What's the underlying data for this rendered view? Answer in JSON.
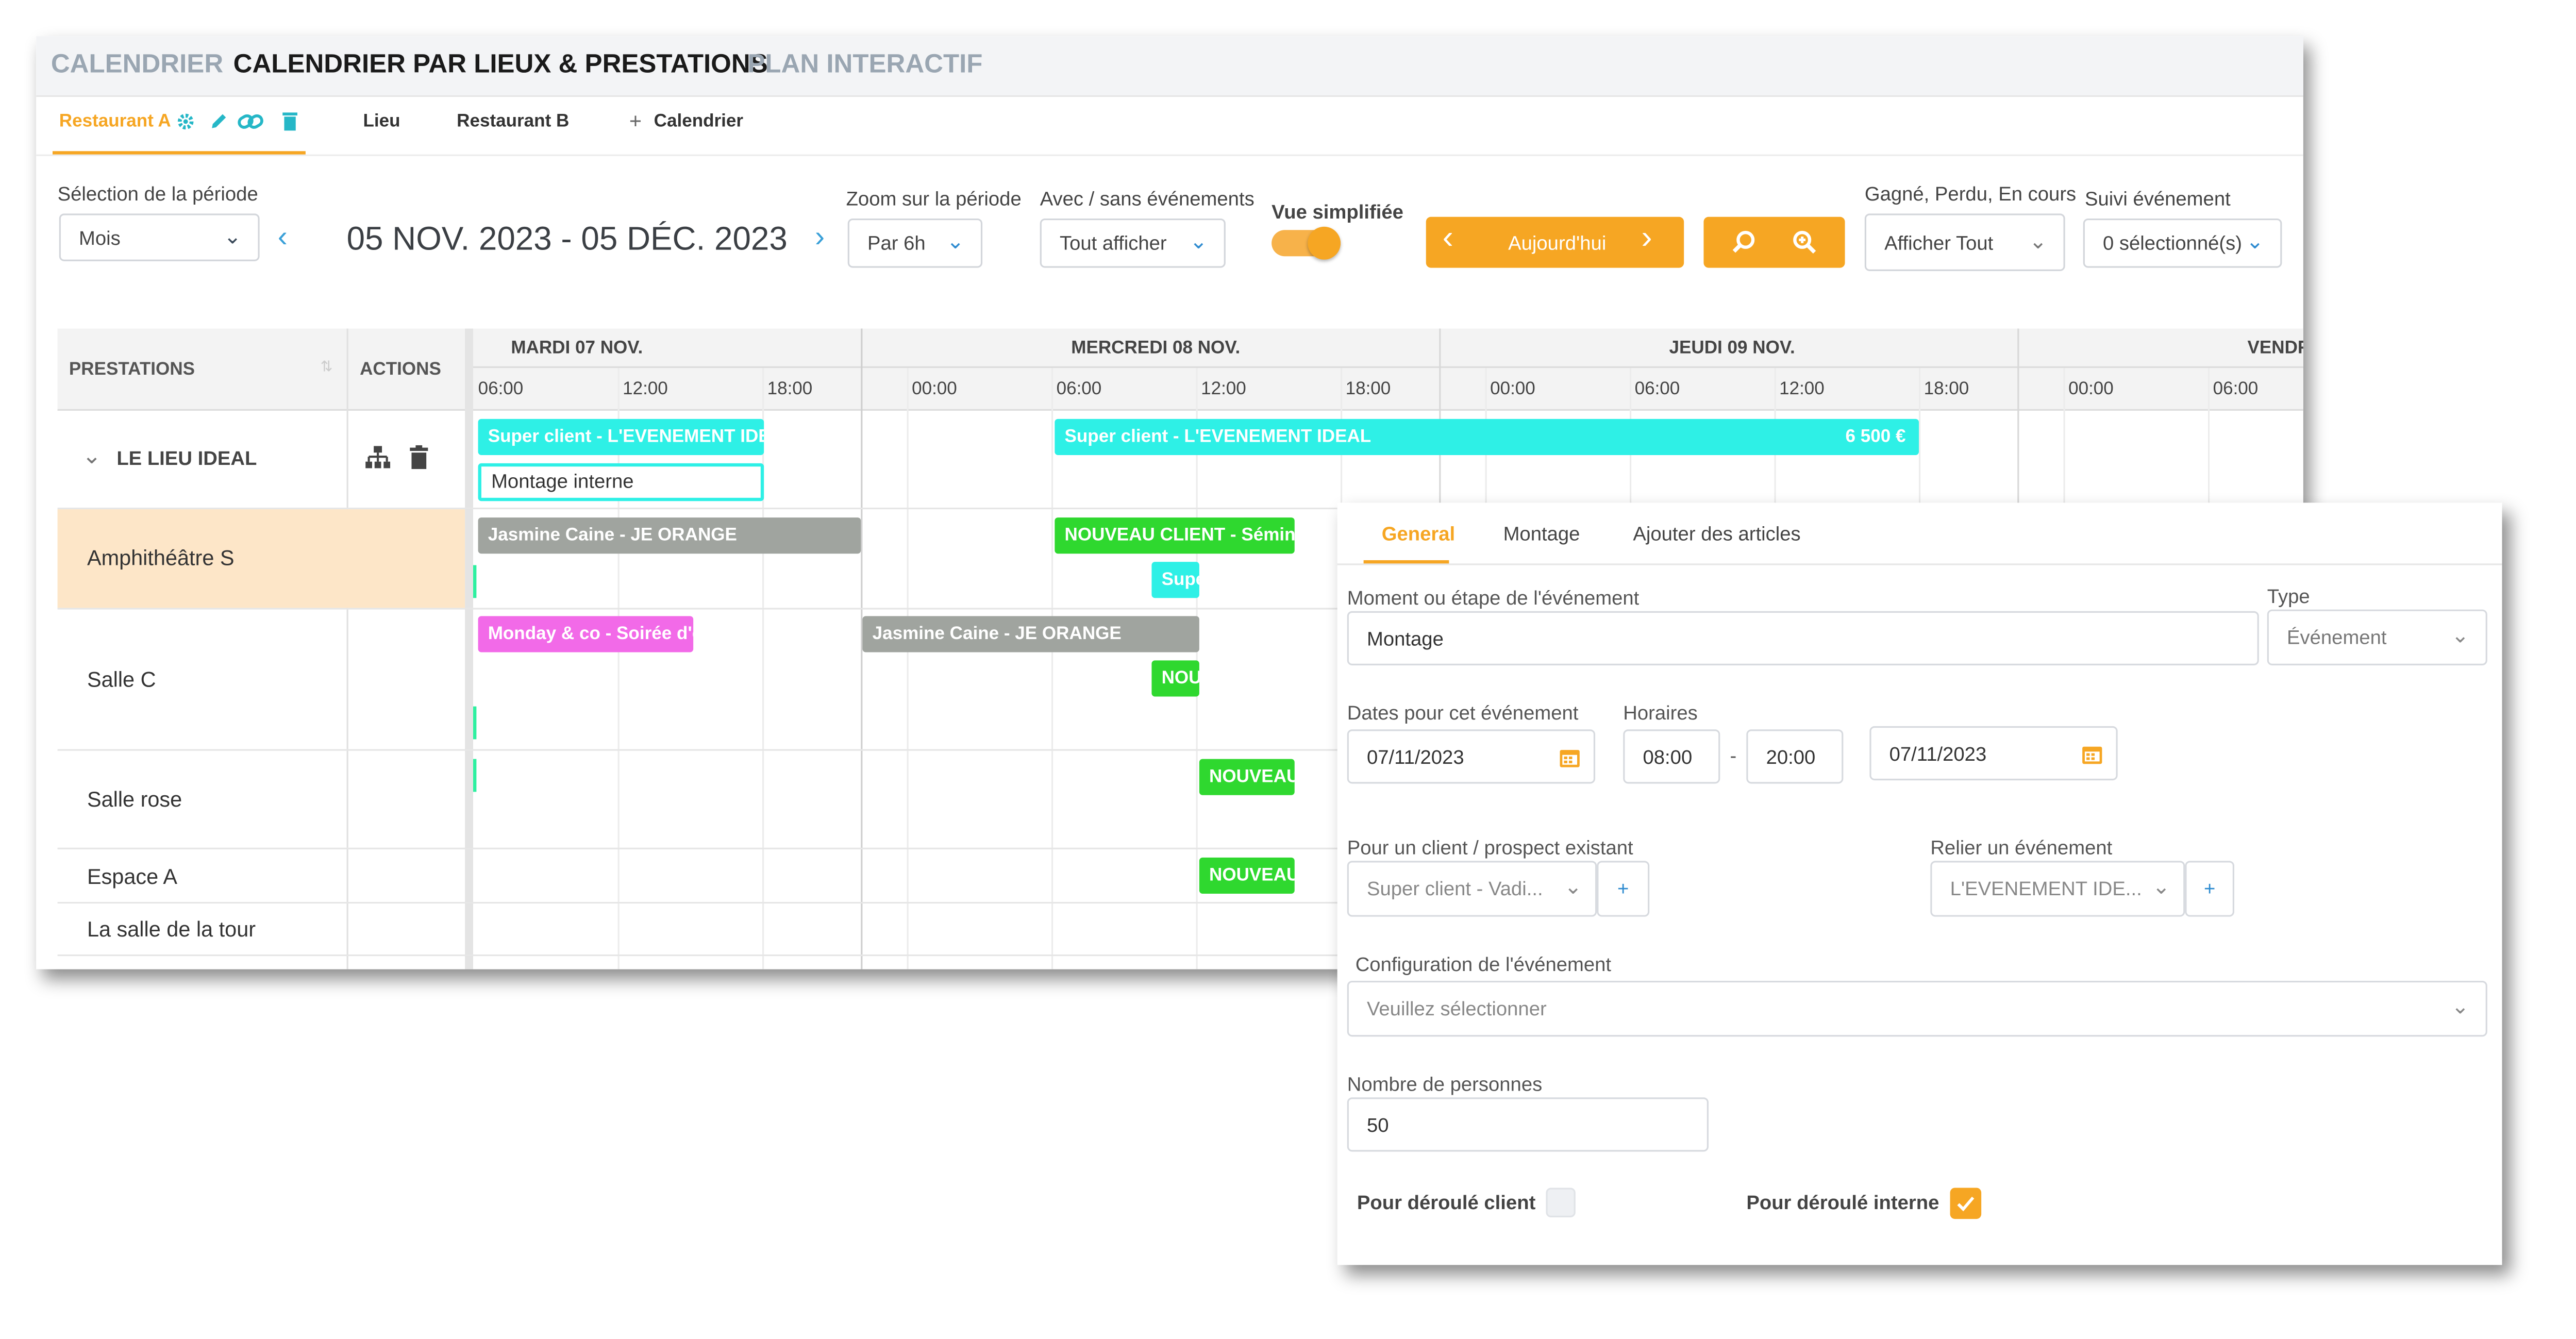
{
  "top_tabs": [
    "CALENDRIER",
    "CALENDRIER PAR LIEUX & PRESTATIONS",
    "PLAN INTERACTIF"
  ],
  "sub_tabs": {
    "restaurant_a": "Restaurant A",
    "lieu": "Lieu",
    "restaurant_b": "Restaurant B",
    "calendrier": "Calendrier"
  },
  "toolbar": {
    "period_label": "Sélection de la période",
    "period_value": "Mois",
    "date_range": "05 NOV. 2023 - 05 DÉC. 2023",
    "zoom_label": "Zoom sur la période",
    "zoom_value": "Par 6h",
    "events_label": "Avec / sans événements",
    "events_value": "Tout afficher",
    "simplified_label": "Vue simplifiée",
    "simplified_on": true,
    "today_label": "Aujourd'hui",
    "status_label": "Gagné, Perdu, En cours",
    "status_value": "Afficher Tout",
    "tracking_label": "Suivi événement",
    "tracking_value": "0 sélectionné(s)"
  },
  "colors": {
    "accent": "#f6a623",
    "cyan": "#2ef0e6",
    "green": "#2fd82f",
    "gray": "#a0a49f",
    "pink": "#f26ae8",
    "highlight_row": "#fde6c8"
  },
  "table": {
    "col_prestations": "PRESTATIONS",
    "col_actions": "ACTIONS",
    "days": [
      "MARDI 07 NOV.",
      "MERCREDI 08 NOV.",
      "JEUDI 09 NOV.",
      "VENDREDI"
    ],
    "hours": [
      "06:00",
      "12:00",
      "18:00",
      "00:00",
      "06:00",
      "12:00",
      "18:00",
      "00:00",
      "06:00",
      "12:00",
      "18:00",
      "00:00",
      "06:00"
    ],
    "group": "LE LIEU IDEAL",
    "rows": [
      "Amphithéâtre S",
      "Salle C",
      "Salle rose",
      "Espace A",
      "La salle de la tour"
    ]
  },
  "events": {
    "e1": "Super client - L'EVENEMENT IDEAL",
    "e2": "Super client - L'EVENEMENT IDEAL",
    "e2_amount": "6 500 €",
    "e3": "Montage interne",
    "e4": "Jasmine Caine - JE ORANGE",
    "e5": "NOUVEAU CLIENT - Séminaire",
    "e6": "Super client",
    "e7": "Monday & co - Soirée d'entreprise",
    "e8": "Jasmine Caine - JE ORANGE",
    "e9": "NOUVEAU CLIENT",
    "e10": "NOUVEAU CLIENT",
    "e11": "NOUVEAU CLIENT"
  },
  "panel": {
    "tabs": [
      "General",
      "Montage",
      "Ajouter des articles"
    ],
    "moment_label": "Moment ou étape de l'événement",
    "moment_value": "Montage",
    "type_label": "Type",
    "type_value": "Événement",
    "dates_label": "Dates pour cet événement",
    "start_date": "07/11/2023",
    "hours_label": "Horaires",
    "hour_start": "08:00",
    "hour_sep": "-",
    "hour_end": "20:00",
    "end_date": "07/11/2023",
    "client_label": "Pour un client / prospect existant",
    "client_value": "Super client - Vadi...",
    "link_label": "Relier un événement",
    "link_value": "L'EVENEMENT IDE...",
    "config_label": "Configuration de l'événement",
    "config_placeholder": "Veuillez sélectionner",
    "persons_label": "Nombre de personnes",
    "persons_value": "50",
    "client_flow_label": "Pour déroulé client",
    "client_flow_checked": false,
    "internal_flow_label": "Pour déroulé interne",
    "internal_flow_checked": true
  }
}
